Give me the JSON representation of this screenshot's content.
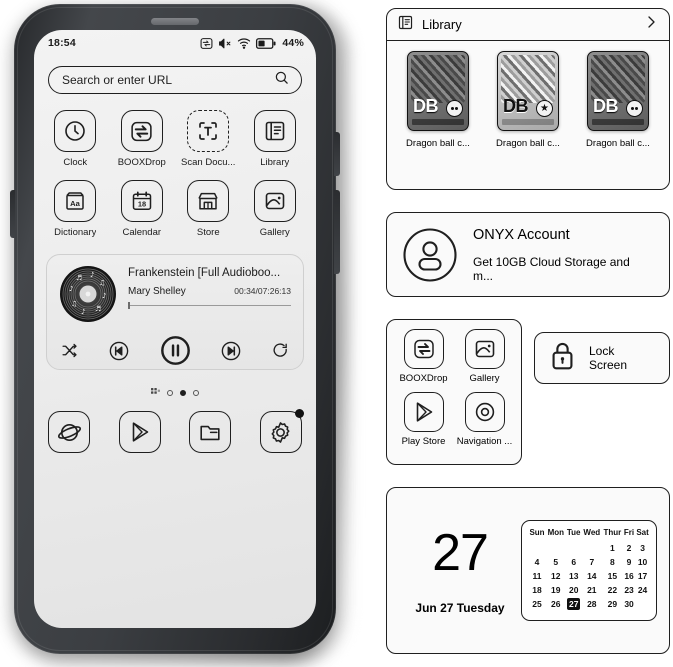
{
  "device": {
    "statusbar": {
      "time": "18:54",
      "battery_percent": "44%",
      "icons": [
        "booxdrop-status-icon",
        "volume-mute-icon",
        "wifi-icon",
        "battery-icon"
      ]
    },
    "search": {
      "placeholder": "Search or enter URL",
      "icon": "search-icon"
    },
    "apps": [
      {
        "label": "Clock",
        "icon": "clock-icon"
      },
      {
        "label": "BOOXDrop",
        "icon": "booxdrop-icon"
      },
      {
        "label": "Scan Docu...",
        "icon": "scan-document-icon"
      },
      {
        "label": "Library",
        "icon": "library-icon"
      },
      {
        "label": "Dictionary",
        "icon": "dictionary-icon"
      },
      {
        "label": "Calendar",
        "icon": "calendar-icon"
      },
      {
        "label": "Store",
        "icon": "store-icon"
      },
      {
        "label": "Gallery",
        "icon": "gallery-icon"
      }
    ],
    "music": {
      "title": "Frankenstein [Full Audioboo...",
      "artist": "Mary Shelley",
      "time": "00:34/07:26:13",
      "progress_percent": 0,
      "controls": [
        "shuffle-icon",
        "previous-track-icon",
        "pause-icon",
        "next-track-icon",
        "repeat-icon"
      ]
    },
    "page_indicator": {
      "icon": "all-apps-grid-icon",
      "dots": 3,
      "active_index": 2
    },
    "dock": [
      {
        "label": "Browser",
        "icon": "browser-planet-icon",
        "badge": false
      },
      {
        "label": "Play Store",
        "icon": "play-store-icon",
        "badge": false
      },
      {
        "label": "File Manager",
        "icon": "folder-icon",
        "badge": false
      },
      {
        "label": "Settings",
        "icon": "gear-icon",
        "badge": true
      }
    ]
  },
  "widgets": {
    "library": {
      "title": "Library",
      "header_icon": "library-icon",
      "chevron": "chevron-right-icon",
      "books": [
        {
          "label": "Dragon ball c...",
          "cover_text": "DB",
          "emblem": "four-star-ball",
          "tone": "dark"
        },
        {
          "label": "Dragon ball c...",
          "cover_text": "DB",
          "emblem": "star",
          "tone": "light"
        },
        {
          "label": "Dragon ball c...",
          "cover_text": "DB",
          "emblem": "four-star-ball",
          "tone": "dark"
        }
      ]
    },
    "account": {
      "icon": "account-avatar-icon",
      "title": "ONYX Account",
      "subtitle": "Get 10GB Cloud Storage and m..."
    },
    "shortcuts": [
      {
        "label": "BOOXDrop",
        "icon": "booxdrop-icon"
      },
      {
        "label": "Gallery",
        "icon": "gallery-icon"
      },
      {
        "label": "Play Store",
        "icon": "play-store-icon"
      },
      {
        "label": "Navigation ...",
        "icon": "navigation-ball-icon"
      }
    ],
    "lock_screen": {
      "label": "Lock Screen",
      "icon": "lock-icon"
    },
    "calendar": {
      "day_number": "27",
      "date_label": "Jun 27 Tuesday",
      "weekdays": [
        "Sun",
        "Mon",
        "Tue",
        "Wed",
        "Thur",
        "Fri",
        "Sat"
      ],
      "weeks": [
        [
          "",
          "",
          "",
          "",
          "1",
          "2",
          "3"
        ],
        [
          "4",
          "5",
          "6",
          "7",
          "8",
          "9",
          "10"
        ],
        [
          "11",
          "12",
          "13",
          "14",
          "15",
          "16",
          "17"
        ],
        [
          "18",
          "19",
          "20",
          "21",
          "22",
          "23",
          "24"
        ],
        [
          "25",
          "26",
          "27",
          "28",
          "29",
          "30",
          ""
        ]
      ],
      "selected_day": "27"
    }
  },
  "colors": {
    "ink": "#1f1f1f",
    "screen_bg": "#ededed",
    "bezel": "#3b3e42",
    "accent": "#111111"
  }
}
